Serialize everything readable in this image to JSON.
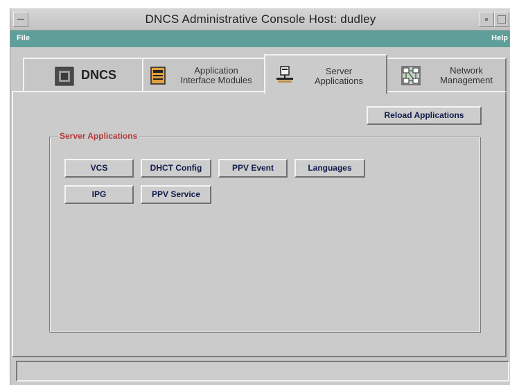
{
  "window": {
    "title": "DNCS Administrative Console   Host: dudley"
  },
  "menubar": {
    "file": "File",
    "help": "Help"
  },
  "tabs": [
    {
      "label": "DNCS",
      "icon": "dncs-icon",
      "active": false
    },
    {
      "label_line1": "Application",
      "label_line2": "Interface Modules",
      "icon": "application-modules-icon",
      "active": false
    },
    {
      "label_line1": "Server",
      "label_line2": "Applications",
      "icon": "server-applications-icon",
      "active": true
    },
    {
      "label_line1": "Network",
      "label_line2": "Management",
      "icon": "network-management-icon",
      "active": false
    }
  ],
  "panel": {
    "reload_button": "Reload Applications",
    "group_title": "Server Applications",
    "buttons_row1": [
      "VCS",
      "DHCT Config",
      "PPV Event",
      "Languages"
    ],
    "buttons_row2": [
      "IPG",
      "PPV Service"
    ]
  },
  "colors": {
    "menubar": "#5f9f9a",
    "group_title": "#b23a3a",
    "button_text": "#111a4a"
  }
}
